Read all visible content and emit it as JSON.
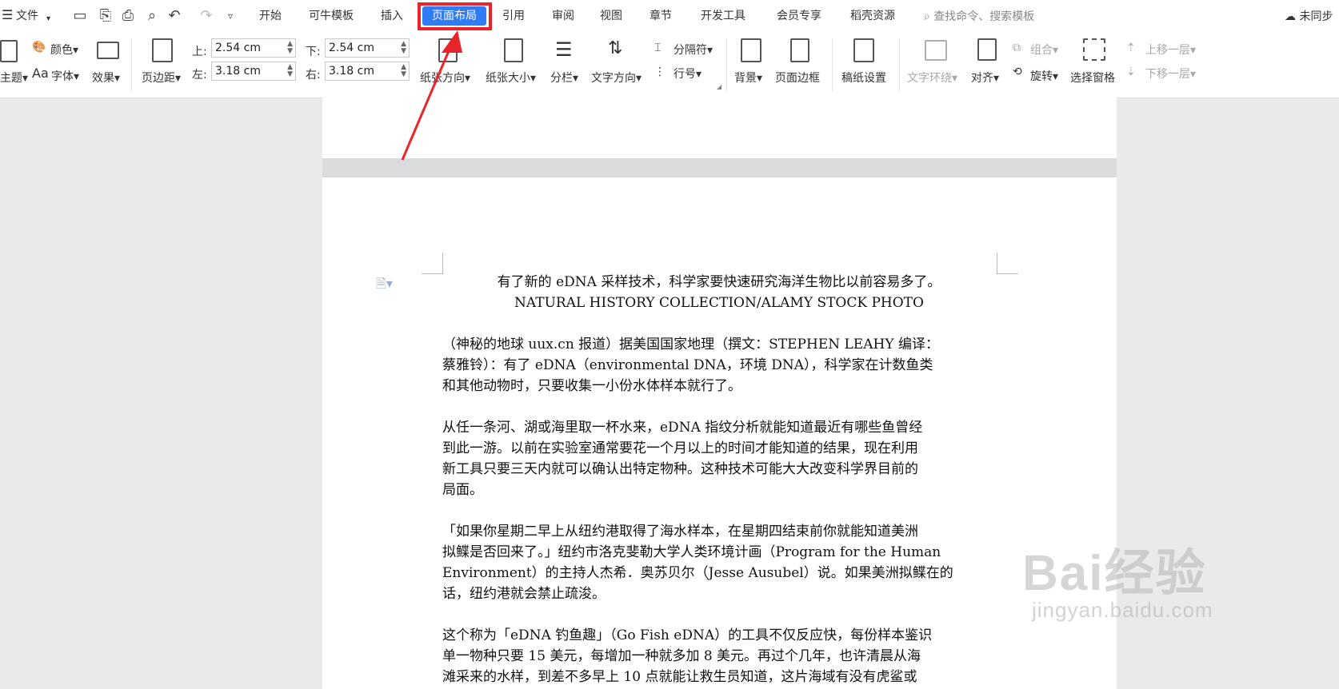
{
  "menubar": {
    "file_label": "文件",
    "tabs": [
      "开始",
      "可牛模板",
      "插入",
      "页面布局",
      "引用",
      "审阅",
      "视图",
      "章节",
      "开发工具",
      "会员专享",
      "稻壳资源"
    ],
    "active_tab": "页面布局",
    "search_placeholder": "查找命令、搜索模板",
    "sync_label": "未同步"
  },
  "ribbon": {
    "theme": "主题",
    "color": "颜色",
    "font": "字体",
    "effect": "效果",
    "margins": "页边距",
    "margin_top_label": "上:",
    "margin_top": "2.54 cm",
    "margin_bottom_label": "下:",
    "margin_bottom": "2.54 cm",
    "margin_left_label": "左:",
    "margin_left": "3.18 cm",
    "margin_right_label": "右:",
    "margin_right": "3.18 cm",
    "orientation": "纸张方向",
    "size": "纸张大小",
    "columns": "分栏",
    "text_direction": "文字方向",
    "breaks": "分隔符",
    "line_numbers": "行号",
    "background": "背景",
    "page_border": "页面边框",
    "manuscript": "稿纸设置",
    "wrap_text": "文字环绕",
    "align": "对齐",
    "group": "组合",
    "rotate": "旋转",
    "selection_pane": "选择窗格",
    "bring_forward": "上移一层",
    "send_backward": "下移一层"
  },
  "document": {
    "caption_line1": "有了新的 eDNA 采样技术，科学家要快速研究海洋生物比以前容易多了。",
    "caption_line2": "NATURAL HISTORY COLLECTION/ALAMY STOCK PHOTO",
    "paragraphs": [
      [
        "（神秘的地球 uux.cn 报道）据美国国家地理（撰文：STEPHEN LEAHY  编译：",
        "蔡雅铃）：有了 eDNA（environmental DNA，环境 DNA），科学家在计数鱼类",
        "和其他动物时，只要收集一小份水体样本就行了。"
      ],
      [
        "从任一条河、湖或海里取一杯水来，eDNA 指纹分析就能知道最近有哪些鱼曾经",
        "到此一游。以前在实验室通常要花一个月以上的时间才能知道的结果，现在利用",
        "新工具只要三天内就可以确认出特定物种。这种技术可能大大改变科学界目前的",
        "局面。"
      ],
      [
        "「如果你星期二早上从纽约港取得了海水样本，在星期四结束前你就能知道美洲",
        "拟鲽是否回来了。」纽约市洛克斐勒大学人类环境计画（Program for the Human",
        "Environment）的主持人杰希．奥苏贝尔（Jesse Ausubel）说。如果美洲拟鲽在的",
        "话，纽约港就会禁止疏浚。"
      ],
      [
        "这个称为「eDNA 钓鱼趣」（Go Fish eDNA）的工具不仅反应快，每份样本鉴识",
        "单一物种只要 15 美元，每增加一种就多加 8 美元。再过个几年，也许清晨从海",
        "滩采来的水样，到差不多早上 10 点就能让救生员知道，这片海域有没有虎鲨或"
      ]
    ]
  },
  "watermark": {
    "brand": "Bai经验",
    "url": "jingyan.baidu.com"
  },
  "colors": {
    "active_tab_bg": "#2f7cf6",
    "highlight_border": "#e8262a",
    "arrow": "#e8262a"
  }
}
